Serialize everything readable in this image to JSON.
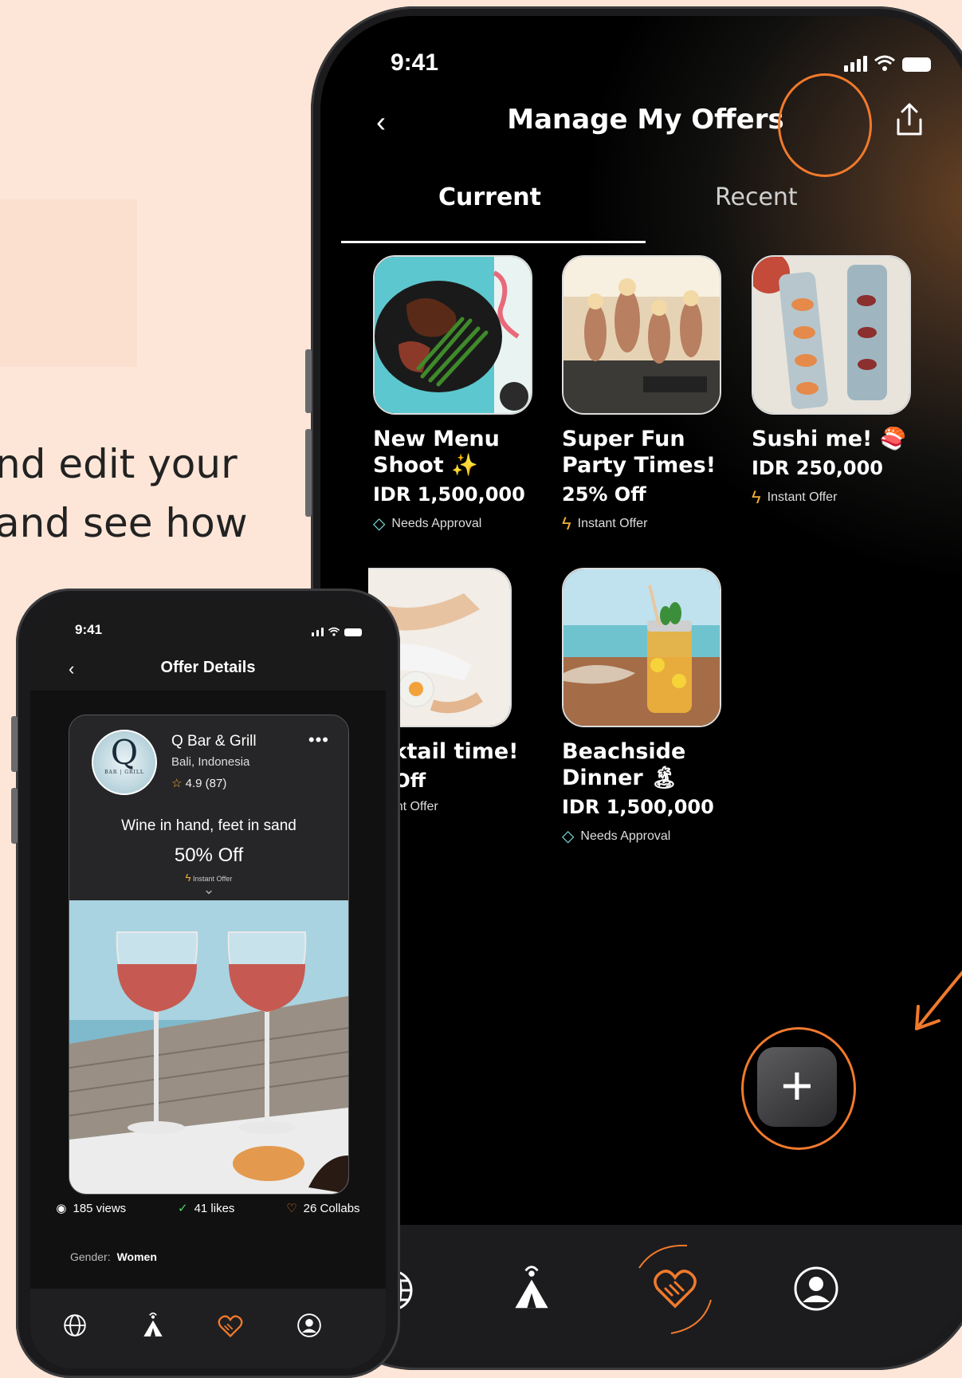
{
  "blurb": {
    "line1": "nd edit your",
    "line2": "and see how"
  },
  "main_phone": {
    "status": {
      "time": "9:41"
    },
    "header": {
      "back": "‹",
      "title": "Manage My Offers"
    },
    "tabs": [
      {
        "label": "Current"
      },
      {
        "label": "Recent"
      }
    ],
    "offers": [
      {
        "title_line1": "New Menu",
        "title_line2": "Shoot ✨",
        "price": "IDR 1,500,000",
        "badge": "Needs Approval",
        "badge_icon": "diamond-icon"
      },
      {
        "title_line1": "Super Fun",
        "title_line2": "Party Times!",
        "price": "25% Off",
        "badge": "Instant Offer",
        "badge_icon": "bolt-icon"
      },
      {
        "title_line1": "Sushi me! 🍣",
        "title_line2": "",
        "price": "IDR 250,000",
        "badge": "Instant Offer",
        "badge_icon": "bolt-icon"
      },
      {
        "title_line1": "ocktail time!",
        "title_line2": "",
        "price": "% Off",
        "badge": "Instant Offer",
        "badge_icon": "bolt-icon"
      },
      {
        "title_line1": "Beachside",
        "title_line2": "Dinner 🏝",
        "price": "IDR 1,500,000",
        "badge": "Needs Approval",
        "badge_icon": "diamond-icon"
      }
    ],
    "fab": "+",
    "nav": [
      "globe-icon",
      "tent-broadcast-icon",
      "handshake-heart-icon",
      "profile-icon"
    ],
    "accent": "#f07a2c"
  },
  "detail_phone": {
    "status": {
      "time": "9:41"
    },
    "header": {
      "back": "‹",
      "title": "Offer Details"
    },
    "business": {
      "name": "Q Bar & Grill",
      "location": "Bali, Indonesia",
      "rating": "4.9 (87)",
      "logo_letter": "Q",
      "logo_sub": "BAR | GRILL"
    },
    "offer": {
      "title": "Wine in hand, feet in sand",
      "discount": "50% Off",
      "badge": "Instant Offer"
    },
    "stats": {
      "views": "185 views",
      "likes": "41 likes",
      "collabs": "26 Collabs"
    },
    "gender_label": "Gender:",
    "gender_value": "Women",
    "nav": [
      "globe-icon",
      "tent-broadcast-icon",
      "handshake-heart-icon",
      "profile-icon"
    ]
  }
}
